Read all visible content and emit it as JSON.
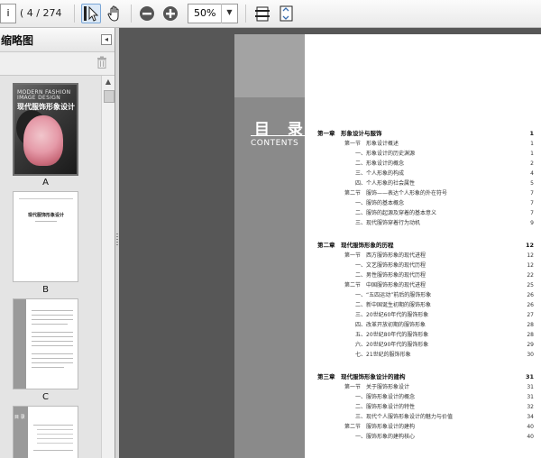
{
  "toolbar": {
    "page_input": "i",
    "page_count": "( 4 / 274 )",
    "zoom_value": "50%",
    "icons": [
      "select-tool-icon",
      "hand-tool-icon",
      "zoom-out-icon",
      "zoom-in-icon",
      "fit-width-icon",
      "fit-page-icon"
    ]
  },
  "sidebar": {
    "title": "缩略图",
    "thumbnails": [
      {
        "label": "A",
        "cover_line1": "MODERN FASHION",
        "cover_line2": "IMAGE DESIGN",
        "cover_title": "现代服饰形象设计"
      },
      {
        "label": "B",
        "title": "现代服饰形象设计"
      },
      {
        "label": "C"
      },
      {
        "label": "",
        "partial_text": "目 录"
      }
    ]
  },
  "document": {
    "heading_zh": "目 录",
    "heading_en": "CONTENTS",
    "toc": [
      {
        "level": 0,
        "text": "第一章　形象设计与服饰",
        "page": "1"
      },
      {
        "level": 1,
        "text": "第一节　形象设计概述",
        "page": "1"
      },
      {
        "level": 2,
        "text": "一、形象设计的历史渊源",
        "page": "1"
      },
      {
        "level": 2,
        "text": "二、形象设计的概念",
        "page": "2"
      },
      {
        "level": 2,
        "text": "三、个人形象的构成",
        "page": "4"
      },
      {
        "level": 2,
        "text": "四、个人形象的社会属性",
        "page": "5"
      },
      {
        "level": 1,
        "text": "第二节　服饰——表达个人形象的外在符号",
        "page": "7"
      },
      {
        "level": 2,
        "text": "一、服饰的基本概念",
        "page": "7"
      },
      {
        "level": 2,
        "text": "二、服饰的起源及穿着的基本意义",
        "page": "7"
      },
      {
        "level": 2,
        "text": "三、现代服饰穿着行为动机",
        "page": "9"
      },
      {
        "level": 0,
        "text": "第二章　现代服饰形象的历程",
        "page": "12"
      },
      {
        "level": 1,
        "text": "第一节　西方服饰形象的现代进程",
        "page": "12"
      },
      {
        "level": 2,
        "text": "一、文艺服饰形象的现代历程",
        "page": "12"
      },
      {
        "level": 2,
        "text": "二、男性服饰形象的现代历程",
        "page": "22"
      },
      {
        "level": 1,
        "text": "第二节　中国服饰形象的现代进程",
        "page": "25"
      },
      {
        "level": 2,
        "text": "一、“五四运动”前后的服饰形象",
        "page": "26"
      },
      {
        "level": 2,
        "text": "二、新中国诞生初期的服饰形象",
        "page": "26"
      },
      {
        "level": 2,
        "text": "三、20世纪60年代的服饰形象",
        "page": "27"
      },
      {
        "level": 2,
        "text": "四、改革开放初期的服饰形象",
        "page": "28"
      },
      {
        "level": 2,
        "text": "五、20世纪80年代的服饰形象",
        "page": "28"
      },
      {
        "level": 2,
        "text": "六、20世纪90年代的服饰形象",
        "page": "29"
      },
      {
        "level": 2,
        "text": "七、21世纪的服饰形象",
        "page": "30"
      },
      {
        "level": 0,
        "text": "第三章　现代服饰形象设计的建构",
        "page": "31"
      },
      {
        "level": 1,
        "text": "第一节　关于服饰形象设计",
        "page": "31"
      },
      {
        "level": 2,
        "text": "一、服饰形象设计的概念",
        "page": "31"
      },
      {
        "level": 2,
        "text": "二、服饰形象设计的特性",
        "page": "32"
      },
      {
        "level": 2,
        "text": "三、现代个人服饰形象设计的魅力与价值",
        "page": "34"
      },
      {
        "level": 1,
        "text": "第二节　服饰形象设计的建构",
        "page": "40"
      },
      {
        "level": 2,
        "text": "一、服饰形象的建构核心",
        "page": "40"
      }
    ]
  }
}
